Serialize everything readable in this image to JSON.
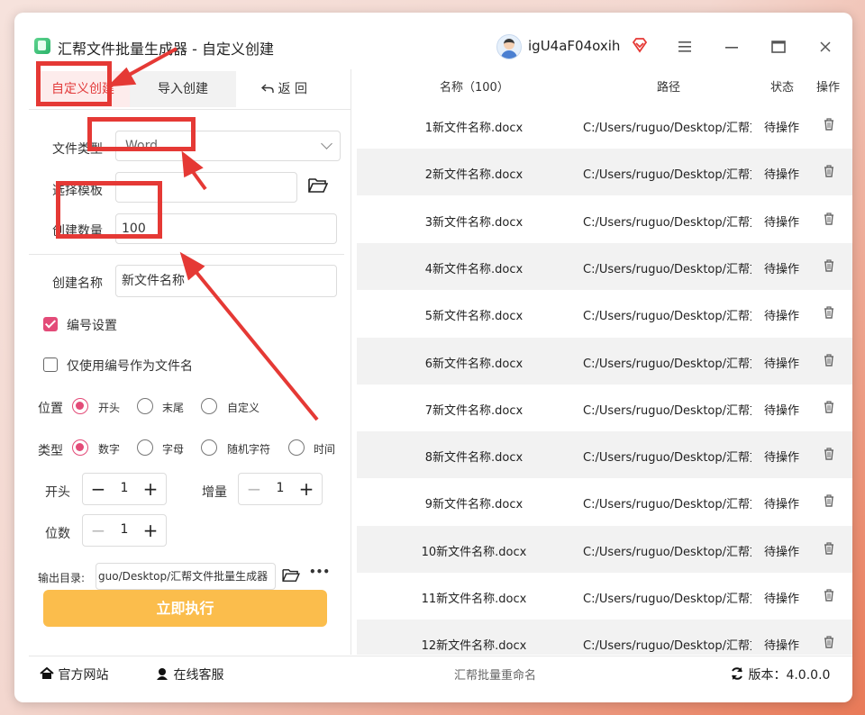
{
  "app": {
    "title": "汇帮文件批量生成器 - 自定义创建",
    "username": "igU4aF04oxih",
    "icons": [
      "app-icon",
      "avatar-icon",
      "vip-diamond-icon",
      "menu-icon",
      "minimize-icon",
      "maximize-icon",
      "close-icon"
    ]
  },
  "tabs": {
    "custom": "自定义创建",
    "import": "导入创建",
    "back": "返 回"
  },
  "form": {
    "file_type_label": "文件类型",
    "file_type_value": "Word",
    "template_label": "选择模板",
    "template_value": "",
    "count_label": "创建数量",
    "count_value": "100",
    "name_label": "创建名称",
    "name_value": "新文件名称",
    "numbering_label": "编号设置",
    "numbering_checked": true,
    "only_number_label": "仅使用编号作为文件名",
    "only_number_checked": false,
    "position_label": "位置",
    "position_options": [
      "开头",
      "末尾",
      "自定义"
    ],
    "position_selected": "开头",
    "type_label": "类型",
    "type_options": [
      "数字",
      "字母",
      "随机字符",
      "时间"
    ],
    "type_selected": "数字",
    "start_label": "开头",
    "start_value": "1",
    "increment_label": "增量",
    "increment_value": "1",
    "digits_label": "位数",
    "digits_value": "1",
    "output_label": "输出目录:",
    "output_value": "guo/Desktop/汇帮文件批量生成器",
    "more_label": "•••",
    "run_label": "立即执行"
  },
  "table": {
    "headers": {
      "name": "名称（100）",
      "path": "路径",
      "status": "状态",
      "action": "操作"
    },
    "rows": [
      {
        "name": "1新文件名称.docx",
        "path": "C:/Users/ruguo/Desktop/汇帮文",
        "status": "待操作"
      },
      {
        "name": "2新文件名称.docx",
        "path": "C:/Users/ruguo/Desktop/汇帮文",
        "status": "待操作"
      },
      {
        "name": "3新文件名称.docx",
        "path": "C:/Users/ruguo/Desktop/汇帮文",
        "status": "待操作"
      },
      {
        "name": "4新文件名称.docx",
        "path": "C:/Users/ruguo/Desktop/汇帮文",
        "status": "待操作"
      },
      {
        "name": "5新文件名称.docx",
        "path": "C:/Users/ruguo/Desktop/汇帮文",
        "status": "待操作"
      },
      {
        "name": "6新文件名称.docx",
        "path": "C:/Users/ruguo/Desktop/汇帮文",
        "status": "待操作"
      },
      {
        "name": "7新文件名称.docx",
        "path": "C:/Users/ruguo/Desktop/汇帮文",
        "status": "待操作"
      },
      {
        "name": "8新文件名称.docx",
        "path": "C:/Users/ruguo/Desktop/汇帮文",
        "status": "待操作"
      },
      {
        "name": "9新文件名称.docx",
        "path": "C:/Users/ruguo/Desktop/汇帮文",
        "status": "待操作"
      },
      {
        "name": "10新文件名称.docx",
        "path": "C:/Users/ruguo/Desktop/汇帮文",
        "status": "待操作"
      },
      {
        "name": "11新文件名称.docx",
        "path": "C:/Users/ruguo/Desktop/汇帮文",
        "status": "待操作"
      },
      {
        "name": "12新文件名称.docx",
        "path": "C:/Users/ruguo/Desktop/汇帮文",
        "status": "待操作"
      }
    ]
  },
  "footer": {
    "website": "官方网站",
    "support": "在线客服",
    "center": "汇帮批量重命名",
    "version": "版本：4.0.0.0"
  },
  "colors": {
    "accent": "#e34b78",
    "tab_active_text": "#e23b3b",
    "run_button": "#fbbd4c",
    "annotation": "#e53935"
  }
}
